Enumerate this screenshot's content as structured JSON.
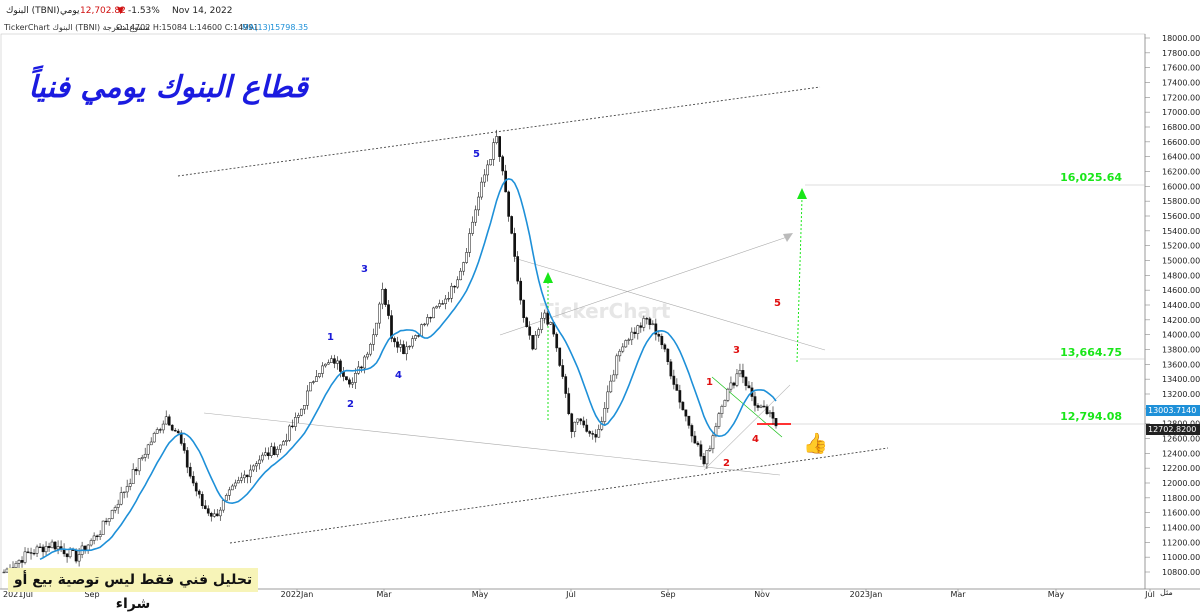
{
  "header": {
    "symbol": "البنوك (TBNI)",
    "period": "يومي",
    "price": "12,702.82",
    "change": "-1.53%",
    "date": "Nov 14, 2022"
  },
  "infobar": {
    "source": "TickerChart البنوك (TBNI) شموع متعرجة",
    "ohlc": "O:14702  H:15084  L:14600  C:14991",
    "ma_label": "MA(13)",
    "ma_value": "15798.35"
  },
  "overlay": {
    "title": "قطاع البنوك يومي فنياً",
    "disclaimer": "تحليل فني فقط ليس توصية بيع أو شراء",
    "watermark": "TickerChart"
  },
  "colors": {
    "ma_line": "#1e90d8",
    "target": "#19e619",
    "wave_primary": "#1a1ad8",
    "wave_secondary": "#e01010",
    "channel": "#444444",
    "candle": "#111111"
  },
  "chart_data": {
    "type": "candlestick",
    "ylim": [
      10800,
      18000
    ],
    "y_ticks": [
      "18000.0000",
      "17800.0000",
      "17600.0000",
      "17400.0000",
      "17200.0000",
      "17000.0000",
      "16800.0000",
      "16600.0000",
      "16400.0000",
      "16200.0000",
      "16000.0000",
      "15800.0000",
      "15600.0000",
      "15400.0000",
      "15200.0000",
      "15000.0000",
      "14800.0000",
      "14600.0000",
      "14400.0000",
      "14200.0000",
      "14000.0000",
      "13800.0000",
      "13600.0000",
      "13400.0000",
      "13200.0000",
      "13000.0000",
      "12800.0000",
      "12600.0000",
      "12400.0000",
      "12200.0000",
      "12000.0000",
      "11800.0000",
      "11600.0000",
      "11400.0000",
      "11200.0000",
      "11000.0000",
      "10800.0000"
    ],
    "x_ticks": [
      "2021Jul",
      "Sep",
      "2022Jan",
      "Mar",
      "May",
      "Jul",
      "Sep",
      "Nov",
      "2023Jan",
      "Mar",
      "May",
      "Jul"
    ],
    "price_path": [
      [
        0,
        10800
      ],
      [
        6,
        11050
      ],
      [
        12,
        11180
      ],
      [
        18,
        11000
      ],
      [
        24,
        11350
      ],
      [
        30,
        11900
      ],
      [
        36,
        12500
      ],
      [
        40,
        12900
      ],
      [
        43,
        12650
      ],
      [
        46,
        12100
      ],
      [
        49,
        11700
      ],
      [
        52,
        11550
      ],
      [
        56,
        11900
      ],
      [
        62,
        12300
      ],
      [
        68,
        12500
      ],
      [
        72,
        12900
      ],
      [
        76,
        13500
      ],
      [
        80,
        13650
      ],
      [
        84,
        13350
      ],
      [
        86,
        13600
      ],
      [
        89,
        14000
      ],
      [
        91,
        14650
      ],
      [
        93,
        14000
      ],
      [
        96,
        13800
      ],
      [
        100,
        14100
      ],
      [
        103,
        14300
      ],
      [
        107,
        14600
      ],
      [
        110,
        15000
      ],
      [
        113,
        15700
      ],
      [
        116,
        16300
      ],
      [
        118,
        16650
      ],
      [
        120,
        15900
      ],
      [
        122,
        15000
      ],
      [
        124,
        14200
      ],
      [
        126,
        13800
      ],
      [
        129,
        14300
      ],
      [
        131,
        14000
      ],
      [
        133,
        13400
      ],
      [
        135,
        12700
      ],
      [
        137,
        12900
      ],
      [
        139,
        12600
      ],
      [
        141,
        12700
      ],
      [
        144,
        13400
      ],
      [
        147,
        13900
      ],
      [
        150,
        14050
      ],
      [
        153,
        14200
      ],
      [
        156,
        14000
      ],
      [
        159,
        13500
      ],
      [
        162,
        13000
      ],
      [
        165,
        12600
      ],
      [
        167,
        12250
      ],
      [
        169,
        12650
      ],
      [
        171,
        13100
      ],
      [
        173,
        13300
      ],
      [
        175,
        13550
      ],
      [
        177,
        13250
      ],
      [
        179,
        13000
      ],
      [
        181,
        12950
      ],
      [
        183,
        12770
      ]
    ],
    "ma_label": "MA(13)",
    "price_labels": [
      "16,025.64",
      "13,664.75",
      "12,794.08"
    ],
    "axis_tags": [
      "13003.7140",
      "12702.8200"
    ],
    "waves_primary": [
      "1",
      "2",
      "3",
      "4",
      "5"
    ],
    "waves_secondary": [
      "1",
      "2",
      "3",
      "4",
      "5"
    ],
    "corner_label": "مثل"
  }
}
